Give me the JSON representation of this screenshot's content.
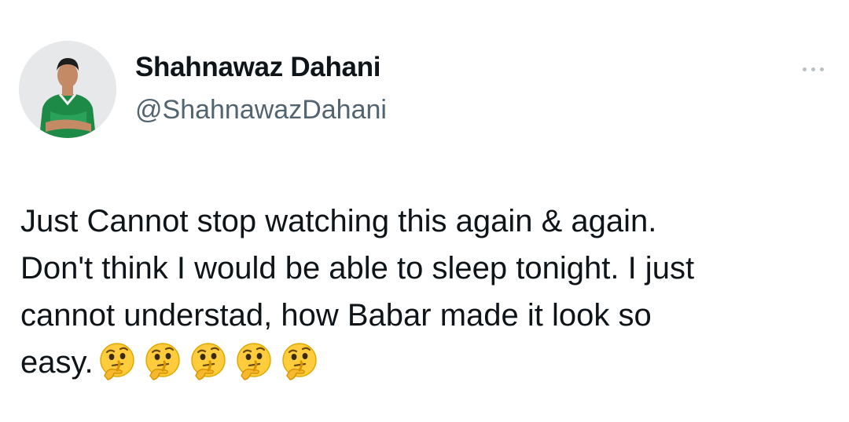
{
  "author": {
    "display_name": "Shahnawaz Dahani",
    "handle": "@ShahnawazDahani",
    "avatar_icon": "profile-photo-avatar"
  },
  "more_icon": "more-horizontal-icon",
  "tweet": {
    "lines": [
      "Just Cannot stop watching this again & again.",
      "Don't think I would be able to sleep tonight. I just",
      "cannot understad, how Babar made it look so",
      "easy."
    ],
    "emojis": [
      "🤔",
      "🤔",
      "🤔",
      "🤔",
      "🤔"
    ]
  },
  "colors": {
    "text_primary": "#0f1419",
    "text_secondary": "#536471",
    "jersey_green": "#1e8a47",
    "emoji_yellow": "#ffcc3d"
  }
}
